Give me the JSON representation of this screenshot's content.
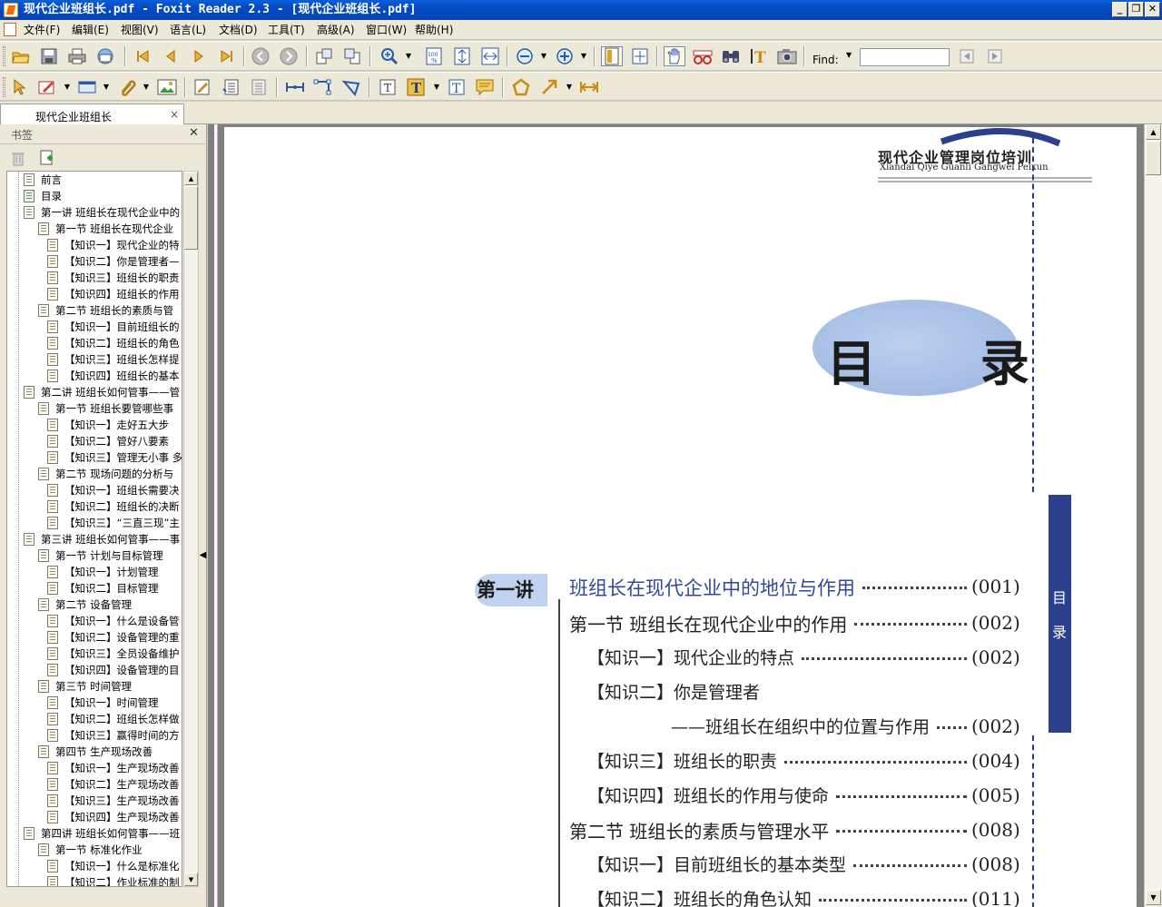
{
  "window": {
    "title": "现代企业班组长.pdf - Foxit Reader 2.3 - [现代企业班组长.pdf]",
    "controls": {
      "minimize": "_",
      "restore": "❐",
      "close": "✕"
    }
  },
  "menu": [
    "文件(F)",
    "编辑(E)",
    "视图(V)",
    "语言(L)",
    "文档(D)",
    "工具(T)",
    "高级(A)",
    "窗口(W)",
    "帮助(H)"
  ],
  "toolbar": {
    "find_label": "Find:",
    "find_value": ""
  },
  "tab": {
    "label": "现代企业班组长",
    "close": "×"
  },
  "sidebar": {
    "title": "书签",
    "close": "✕",
    "collapse_arrow": "◀",
    "bookmarks": [
      {
        "text": "前言",
        "level": 0,
        "icon": "page-icon"
      },
      {
        "text": "目录",
        "level": 0,
        "icon": "page-icon-green"
      },
      {
        "text": "第一讲  班组长在现代企业中的",
        "level": 0,
        "icon": "page-icon"
      },
      {
        "text": "第一节  班组长在现代企业",
        "level": 1,
        "icon": "page-icon"
      },
      {
        "text": "【知识一】现代企业的特",
        "level": 2,
        "icon": "page-icon"
      },
      {
        "text": "【知识二】你是管理者—",
        "level": 2,
        "icon": "page-icon"
      },
      {
        "text": "【知识三】班组长的职责",
        "level": 2,
        "icon": "page-icon"
      },
      {
        "text": "【知识四】班组长的作用",
        "level": 2,
        "icon": "page-icon"
      },
      {
        "text": "第二节  班组长的素质与管",
        "level": 1,
        "icon": "page-icon"
      },
      {
        "text": "【知识一】目前班组长的",
        "level": 2,
        "icon": "page-icon"
      },
      {
        "text": "【知识二】班组长的角色",
        "level": 2,
        "icon": "page-icon"
      },
      {
        "text": "【知识三】班组长怎样提",
        "level": 2,
        "icon": "page-icon"
      },
      {
        "text": "【知识四】班组长的基本",
        "level": 2,
        "icon": "page-icon"
      },
      {
        "text": "第二讲  班组长如何管事——管",
        "level": 0,
        "icon": "page-icon"
      },
      {
        "text": "第一节  班组长要管哪些事",
        "level": 1,
        "icon": "page-icon"
      },
      {
        "text": "【知识一】走好五大步",
        "level": 2,
        "icon": "page-icon"
      },
      {
        "text": "【知识二】管好八要素",
        "level": 2,
        "icon": "page-icon"
      },
      {
        "text": "【知识三】管理无小事  多",
        "level": 2,
        "icon": "page-icon"
      },
      {
        "text": "第二节  现场问题的分析与",
        "level": 1,
        "icon": "page-icon"
      },
      {
        "text": "【知识一】班组长需要决",
        "level": 2,
        "icon": "page-icon"
      },
      {
        "text": "【知识二】班组长的决断",
        "level": 2,
        "icon": "page-icon"
      },
      {
        "text": "【知识三】“三直三现”主",
        "level": 2,
        "icon": "page-icon"
      },
      {
        "text": "第三讲  班组长如何管事——事",
        "level": 0,
        "icon": "page-icon"
      },
      {
        "text": "第一节  计划与目标管理",
        "level": 1,
        "icon": "page-icon"
      },
      {
        "text": "【知识一】计划管理",
        "level": 2,
        "icon": "page-icon"
      },
      {
        "text": "【知识二】目标管理",
        "level": 2,
        "icon": "page-icon"
      },
      {
        "text": "第二节  设备管理",
        "level": 1,
        "icon": "page-icon"
      },
      {
        "text": "【知识一】什么是设备管",
        "level": 2,
        "icon": "page-icon"
      },
      {
        "text": "【知识二】设备管理的重",
        "level": 2,
        "icon": "page-icon"
      },
      {
        "text": "【知识三】全员设备维护",
        "level": 2,
        "icon": "page-icon"
      },
      {
        "text": "【知识四】设备管理的目",
        "level": 2,
        "icon": "page-icon"
      },
      {
        "text": "第三节  时间管理",
        "level": 1,
        "icon": "page-icon"
      },
      {
        "text": "【知识一】时间管理",
        "level": 2,
        "icon": "page-icon"
      },
      {
        "text": "【知识二】班组长怎样做",
        "level": 2,
        "icon": "page-icon"
      },
      {
        "text": "【知识三】赢得时间的方",
        "level": 2,
        "icon": "page-icon"
      },
      {
        "text": "第四节  生产现场改善",
        "level": 1,
        "icon": "page-icon"
      },
      {
        "text": "【知识一】生产现场改善",
        "level": 2,
        "icon": "page-icon"
      },
      {
        "text": "【知识二】生产现场改善",
        "level": 2,
        "icon": "page-icon"
      },
      {
        "text": "【知识三】生产现场改善",
        "level": 2,
        "icon": "page-icon"
      },
      {
        "text": "【知识四】生产现场改善",
        "level": 2,
        "icon": "page-icon"
      },
      {
        "text": "第四讲  班组长如何管事——班",
        "level": 0,
        "icon": "page-icon"
      },
      {
        "text": "第一节  标准化作业",
        "level": 1,
        "icon": "page-icon"
      },
      {
        "text": "【知识一】什么是标准化",
        "level": 2,
        "icon": "page-icon"
      },
      {
        "text": "【知识二】作业标准的制",
        "level": 2,
        "icon": "page-icon"
      }
    ]
  },
  "pdf": {
    "series_cn": "现代企业管理岗位培训",
    "series_en": "Xiandai Qiye Guanli Gangwei Peixun",
    "side_tab": [
      "目",
      "录"
    ],
    "heading": "目 录",
    "chapter_label": "第一讲",
    "toc": [
      {
        "text": "班组长在现代企业中的地位与作用",
        "page": "(001)",
        "style": "l1"
      },
      {
        "text": "第一节   班组长在现代企业中的作用",
        "page": "(002)",
        "style": "l2"
      },
      {
        "text": "【知识一】现代企业的特点",
        "page": "(002)",
        "style": "l3"
      },
      {
        "text": "【知识二】你是管理者",
        "page": "",
        "style": "l3"
      },
      {
        "text": "——班组长在组织中的位置与作用",
        "page": "(002)",
        "style": "l3"
      },
      {
        "text": "【知识三】班组长的职责",
        "page": "(004)",
        "style": "l3"
      },
      {
        "text": "【知识四】班组长的作用与使命",
        "page": "(005)",
        "style": "l3"
      },
      {
        "text": "第二节   班组长的素质与管理水平",
        "page": "(008)",
        "style": "l2"
      },
      {
        "text": "【知识一】目前班组长的基本类型",
        "page": "(008)",
        "style": "l3"
      },
      {
        "text": "【知识二】班组长的角色认知",
        "page": "(011)",
        "style": "l3"
      }
    ]
  },
  "colors": {
    "titlebar": "#0549c4",
    "accent_blue": "#2c3f8c",
    "link_blue": "#2f4a98",
    "ellipse": "#9ab4e0"
  }
}
